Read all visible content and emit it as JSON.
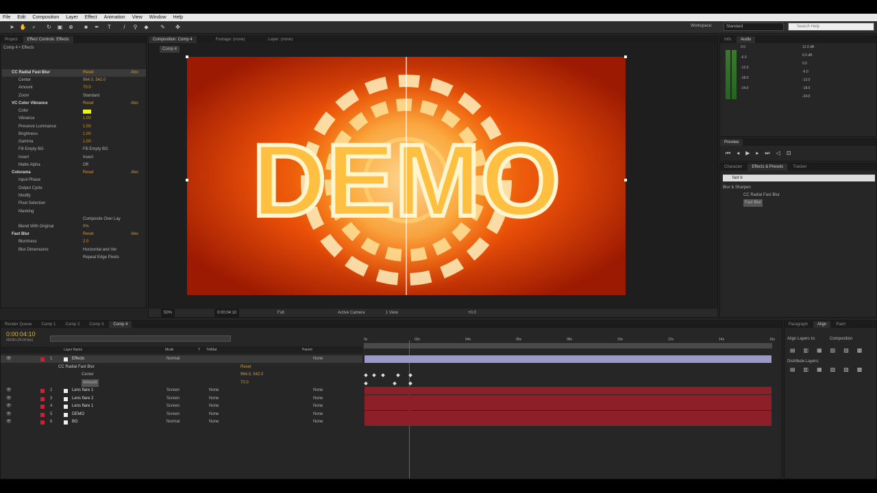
{
  "menu": [
    "File",
    "Edit",
    "Composition",
    "Layer",
    "Effect",
    "Animation",
    "View",
    "Window",
    "Help"
  ],
  "workspace": {
    "label": "Workspace:",
    "value": "Standard",
    "search_placeholder": "Search Help"
  },
  "project_panel": {
    "tabs": [
      "Project",
      "Effect Controls: Effects"
    ],
    "breadcrumb": "Comp 4 • Effects",
    "reset_label": "Reset",
    "about_label": "Abo",
    "effects": [
      {
        "name": "CC Radial Fast Blur",
        "props": [
          {
            "label": "Center",
            "value": "964.0, 542.0"
          },
          {
            "label": "Amount",
            "value": "70.0"
          },
          {
            "label": "Zoom",
            "value": "Standard"
          }
        ]
      },
      {
        "name": "VC Color Vibrance",
        "props": [
          {
            "label": "Color",
            "value": ""
          },
          {
            "label": "Vibrance",
            "value": "1.00"
          },
          {
            "label": "Preserve Luminance",
            "value": "1.00"
          },
          {
            "label": "Brightness",
            "value": "1.00"
          },
          {
            "label": "Gamma",
            "value": "1.00"
          },
          {
            "label": "Fill Empty BG",
            "value": "Fill Empty BG"
          },
          {
            "label": "Invert",
            "value": "Invert"
          },
          {
            "label": "Matte Alpha",
            "value": "Off"
          }
        ]
      },
      {
        "name": "Colorama",
        "props": [
          {
            "label": "Input Phase",
            "value": ""
          },
          {
            "label": "Output Cycle",
            "value": ""
          },
          {
            "label": "Modify",
            "value": ""
          },
          {
            "label": "Pixel Selection",
            "value": ""
          },
          {
            "label": "Masking",
            "value": ""
          },
          {
            "label": "",
            "value": "Composite Over Lay"
          },
          {
            "label": "Blend With Original",
            "value": "0%"
          }
        ]
      },
      {
        "name": "Fast Blur",
        "props": [
          {
            "label": "Blurriness",
            "value": "2.0"
          },
          {
            "label": "Blur Dimensions",
            "value": "Horizontal and Ver"
          },
          {
            "label": "",
            "value": "Repeat Edge Pixels"
          }
        ]
      }
    ]
  },
  "comp_panel": {
    "tabs": [
      "Composition: Comp 4",
      "Footage: (none)",
      "Layer: (none)"
    ],
    "sub_tab": "Comp 4",
    "footer": {
      "zoom": "50%",
      "timecode": "0:00:04:10",
      "resolution": "Full",
      "camera": "Active Camera",
      "views": "1 View",
      "exposure": "+0.0"
    }
  },
  "info_panel": {
    "tabs": [
      "Info",
      "Audio"
    ],
    "db_left": [
      "0.0",
      "-6.0",
      "-12.0",
      "-18.0",
      "-24.0"
    ],
    "db_right": [
      "12.0 dB",
      "6.0 dB",
      "0.0",
      "-6.0",
      "-12.0",
      "-18.0",
      "-24.0"
    ]
  },
  "preview_panel": {
    "tabs": [
      "Preview"
    ]
  },
  "effects_presets": {
    "tabs": [
      "Character",
      "Effects & Presets",
      "Tracker"
    ],
    "search": "fast b",
    "category": "Blur & Sharpen",
    "items": [
      "CC Radial Fast Blur",
      "Fast Blur"
    ]
  },
  "timeline": {
    "tabs": [
      "Render Queue",
      "Comp 1",
      "Comp 2",
      "Comp 3",
      "Comp 4"
    ],
    "timecode": "0:00:04:10",
    "frames": "00106 (24.00 fps)",
    "columns": [
      "Layer Name",
      "Mode",
      "T",
      "TrkMat",
      "Parent"
    ],
    "layers": [
      {
        "num": "1",
        "name": "Effects",
        "mode": "Normal",
        "trkmat": "",
        "parent": "None"
      },
      {
        "num": "2",
        "name": "Lens flare 1",
        "mode": "Screen",
        "trkmat": "None",
        "parent": "None"
      },
      {
        "num": "3",
        "name": "Lens flare 2",
        "mode": "Screen",
        "trkmat": "None",
        "parent": "None"
      },
      {
        "num": "4",
        "name": "Lens flare 1",
        "mode": "Screen",
        "trkmat": "None",
        "parent": "None"
      },
      {
        "num": "5",
        "name": "DEMO",
        "mode": "Screen",
        "trkmat": "None",
        "parent": "None"
      },
      {
        "num": "6",
        "name": "BG",
        "mode": "Normal",
        "trkmat": "None",
        "parent": "None"
      }
    ],
    "sub": {
      "effect": "CC Radial Fast Blur",
      "center_label": "Center",
      "amount_label": "Amount",
      "reset": "Reset",
      "center_value": "964.0, 542.0",
      "amount_value": "70.0"
    },
    "ruler": [
      "0s",
      "02s",
      "04s",
      "06s",
      "08s",
      "10s",
      "12s",
      "14s",
      "16s"
    ]
  },
  "align_panel": {
    "tabs": [
      "Paragraph",
      "Align",
      "Paint"
    ],
    "align_to_label": "Align Layers to:",
    "align_to": "Composition",
    "distribute": "Distribute Layers:"
  },
  "canvas": {
    "text": "DEMO"
  }
}
